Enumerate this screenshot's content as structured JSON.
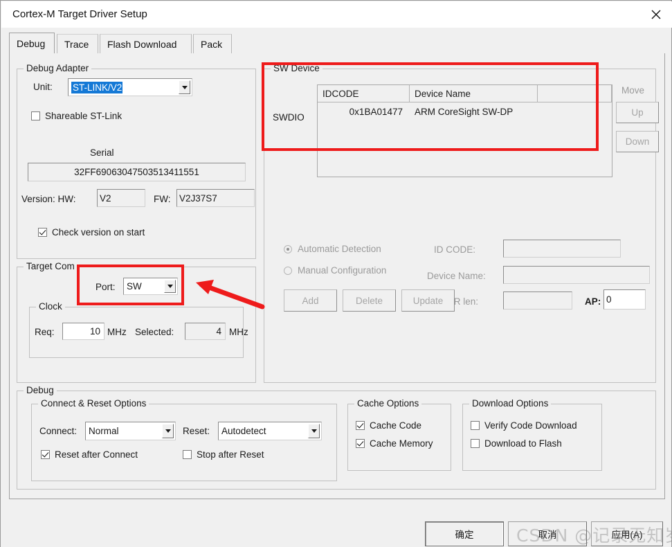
{
  "window": {
    "title": "Cortex-M Target Driver Setup",
    "close_icon": "close-icon"
  },
  "tabs": [
    {
      "label": "Debug",
      "selected": true
    },
    {
      "label": "Trace",
      "selected": false
    },
    {
      "label": "Flash Download",
      "selected": false
    },
    {
      "label": "Pack",
      "selected": false
    }
  ],
  "debug_adapter": {
    "legend": "Debug Adapter",
    "unit_label": "Unit:",
    "unit_value": "ST-LINK/V2",
    "shareable_label": "Shareable ST-Link",
    "shareable_checked": false,
    "serial_label": "Serial",
    "serial_value": "32FF69063047503513411551",
    "version_label": "Version: HW:",
    "hw_value": "V2",
    "fw_label": "FW:",
    "fw_value": "V2J37S7",
    "check_version_label": "Check version on start",
    "check_version_checked": true
  },
  "target_com": {
    "legend": "Target Com",
    "port_label": "Port:",
    "port_value": "SW",
    "clock_legend": "Clock",
    "req_label": "Req:",
    "req_value": "10",
    "req_unit": "MHz",
    "selected_label": "Selected:",
    "selected_value": "4",
    "selected_unit": "MHz"
  },
  "sw_device": {
    "legend": "SW Device",
    "bus_label": "SWDIO",
    "columns": [
      "IDCODE",
      "Device Name",
      ""
    ],
    "rows": [
      {
        "idcode": "0x1BA01477",
        "device_name": "ARM CoreSight SW-DP"
      }
    ],
    "move_label": "Move",
    "up_label": "Up",
    "down_label": "Down",
    "automatic_detection_label": "Automatic Detection",
    "automatic_detection_selected": true,
    "manual_configuration_label": "Manual Configuration",
    "manual_configuration_selected": false,
    "id_code_label": "ID CODE:",
    "id_code_value": "",
    "device_name_label": "Device Name:",
    "device_name_value": "",
    "ir_len_label": "IR len:",
    "ir_len_value": "",
    "ap_label": "AP:",
    "ap_value": "0",
    "add_label": "Add",
    "delete_label": "Delete",
    "update_label": "Update"
  },
  "debug_group": {
    "legend": "Debug",
    "connect_reset": {
      "legend": "Connect & Reset Options",
      "connect_label": "Connect:",
      "connect_value": "Normal",
      "reset_label": "Reset:",
      "reset_value": "Autodetect",
      "reset_after_connect_label": "Reset after Connect",
      "reset_after_connect_checked": true,
      "stop_after_reset_label": "Stop after Reset",
      "stop_after_reset_checked": false
    },
    "cache": {
      "legend": "Cache Options",
      "cache_code_label": "Cache Code",
      "cache_code_checked": true,
      "cache_memory_label": "Cache Memory",
      "cache_memory_checked": true
    },
    "download": {
      "legend": "Download Options",
      "verify_code_download_label": "Verify Code Download",
      "verify_code_download_checked": false,
      "download_to_flash_label": "Download to Flash",
      "download_to_flash_checked": false
    }
  },
  "footer": {
    "ok_label": "确定",
    "cancel_label": "取消",
    "apply_label": "应用(A)"
  },
  "watermark": {
    "text": "CSDN @记录无知岁月"
  },
  "annotations": {
    "highlight_color": "#ee1b1b"
  }
}
